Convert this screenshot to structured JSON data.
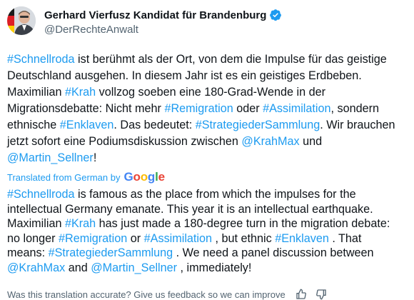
{
  "author": {
    "display_name": "Gerhard Vierfusz Kandidat für Brandenburg",
    "handle": "@DerRechteAnwalt",
    "verified": true
  },
  "post": {
    "original": [
      {
        "t": "#Schnellroda",
        "link": true
      },
      {
        "t": " ist berühmt als der Ort, von dem die Impulse für das geistige Deutschland ausgehen. In diesem Jahr ist es ein geistiges Erdbeben. Maximilian ",
        "link": false
      },
      {
        "t": "#Krah",
        "link": true
      },
      {
        "t": " vollzog soeben eine 180-Grad-Wende in der Migrationsdebatte: Nicht mehr ",
        "link": false
      },
      {
        "t": "#Remigration",
        "link": true
      },
      {
        "t": " oder ",
        "link": false
      },
      {
        "t": "#Assimilation",
        "link": true
      },
      {
        "t": ", sondern ethnische ",
        "link": false
      },
      {
        "t": "#Enklaven",
        "link": true
      },
      {
        "t": ". Das bedeutet: ",
        "link": false
      },
      {
        "t": "#StrategiederSammlung",
        "link": true
      },
      {
        "t": ". Wir brauchen jetzt sofort eine Podiumsdiskussion zwischen ",
        "link": false
      },
      {
        "t": "@KrahMax",
        "link": true
      },
      {
        "t": " und ",
        "link": false
      },
      {
        "t": "@Martin_Sellner",
        "link": true
      },
      {
        "t": "!",
        "link": false
      }
    ],
    "translated_label": "Translated from German by",
    "google_letters": [
      "G",
      "o",
      "o",
      "g",
      "l",
      "e"
    ],
    "translation": [
      {
        "t": "#Schnellroda",
        "link": true
      },
      {
        "t": " is famous as the place from which the impulses for the intellectual Germany emanate. This year it is an intellectual earthquake. Maximilian ",
        "link": false
      },
      {
        "t": "#Krah",
        "link": true
      },
      {
        "t": " has just made a 180-degree turn in the migration debate: no longer ",
        "link": false
      },
      {
        "t": "#Remigration",
        "link": true
      },
      {
        "t": " or ",
        "link": false
      },
      {
        "t": "#Assimilation",
        "link": true
      },
      {
        "t": " , but ethnic ",
        "link": false
      },
      {
        "t": "#Enklaven",
        "link": true
      },
      {
        "t": " . That means: ",
        "link": false
      },
      {
        "t": "#StrategiederSammlung",
        "link": true
      },
      {
        "t": " . We need a panel discussion between ",
        "link": false
      },
      {
        "t": "@KrahMax",
        "link": true
      },
      {
        "t": " and ",
        "link": false
      },
      {
        "t": "@Martin_Sellner",
        "link": true
      },
      {
        "t": " , immediately!",
        "link": false
      }
    ],
    "feedback_text": "Was this translation accurate? Give us feedback so we can improve"
  },
  "colors": {
    "link": "#1d9bf0",
    "text": "#0f1419",
    "secondary": "#536471",
    "verified": "#1d9bf0"
  },
  "icons": [
    "verified-badge-icon",
    "thumbs-up-icon",
    "thumbs-down-icon"
  ]
}
